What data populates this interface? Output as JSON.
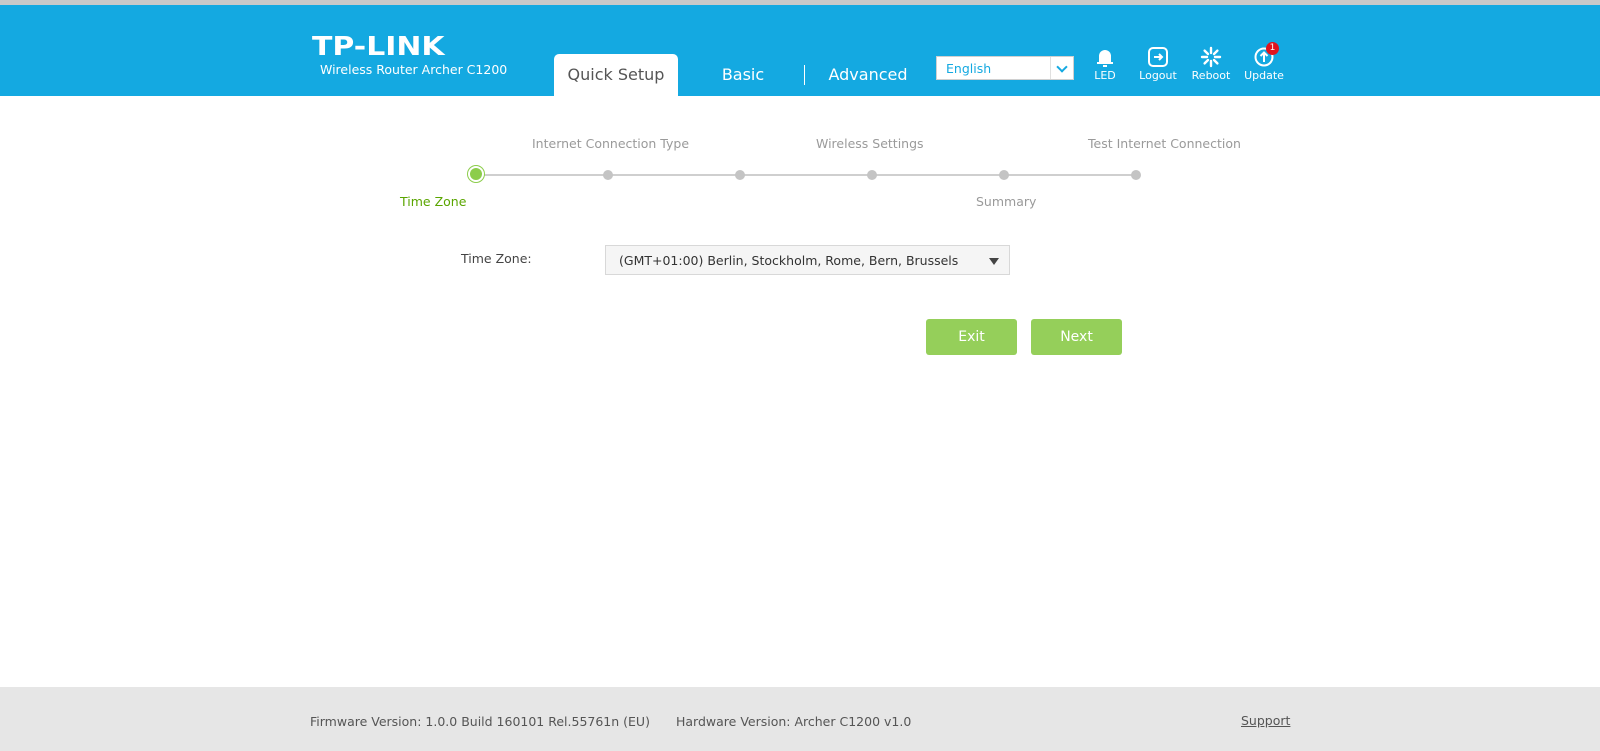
{
  "brand": {
    "logo": "TP-LINK",
    "model": "Wireless Router Archer C1200",
    "header_color": "#14a9e1"
  },
  "tabs": [
    {
      "label": "Quick Setup",
      "active": true
    },
    {
      "label": "Basic",
      "active": false
    },
    {
      "label": "Advanced",
      "active": false
    }
  ],
  "language": {
    "selected": "English"
  },
  "header_actions": [
    {
      "label": "LED",
      "icon": "bell-icon"
    },
    {
      "label": "Logout",
      "icon": "logout-icon"
    },
    {
      "label": "Reboot",
      "icon": "reboot-icon"
    },
    {
      "label": "Update",
      "icon": "update-icon",
      "badge": "1"
    }
  ],
  "wizard": {
    "steps": [
      {
        "label": "Time Zone",
        "active": true
      },
      {
        "label": "Internet Connection Type",
        "active": false
      },
      {
        "label": "",
        "active": false
      },
      {
        "label": "Wireless Settings",
        "active": false
      },
      {
        "label": "Summary",
        "active": false
      },
      {
        "label": "Test Internet Connection",
        "active": false
      }
    ],
    "active_color": "#5aa500"
  },
  "form": {
    "timezone_label": "Time Zone:",
    "timezone_value": "(GMT+01:00) Berlin, Stockholm, Rome, Bern, Brussels"
  },
  "buttons": {
    "exit": "Exit",
    "next": "Next",
    "color": "#95cf5a"
  },
  "footer": {
    "firmware": "Firmware Version: 1.0.0 Build 160101 Rel.55761n (EU)",
    "hardware": "Hardware Version: Archer C1200 v1.0",
    "support": "Support"
  }
}
